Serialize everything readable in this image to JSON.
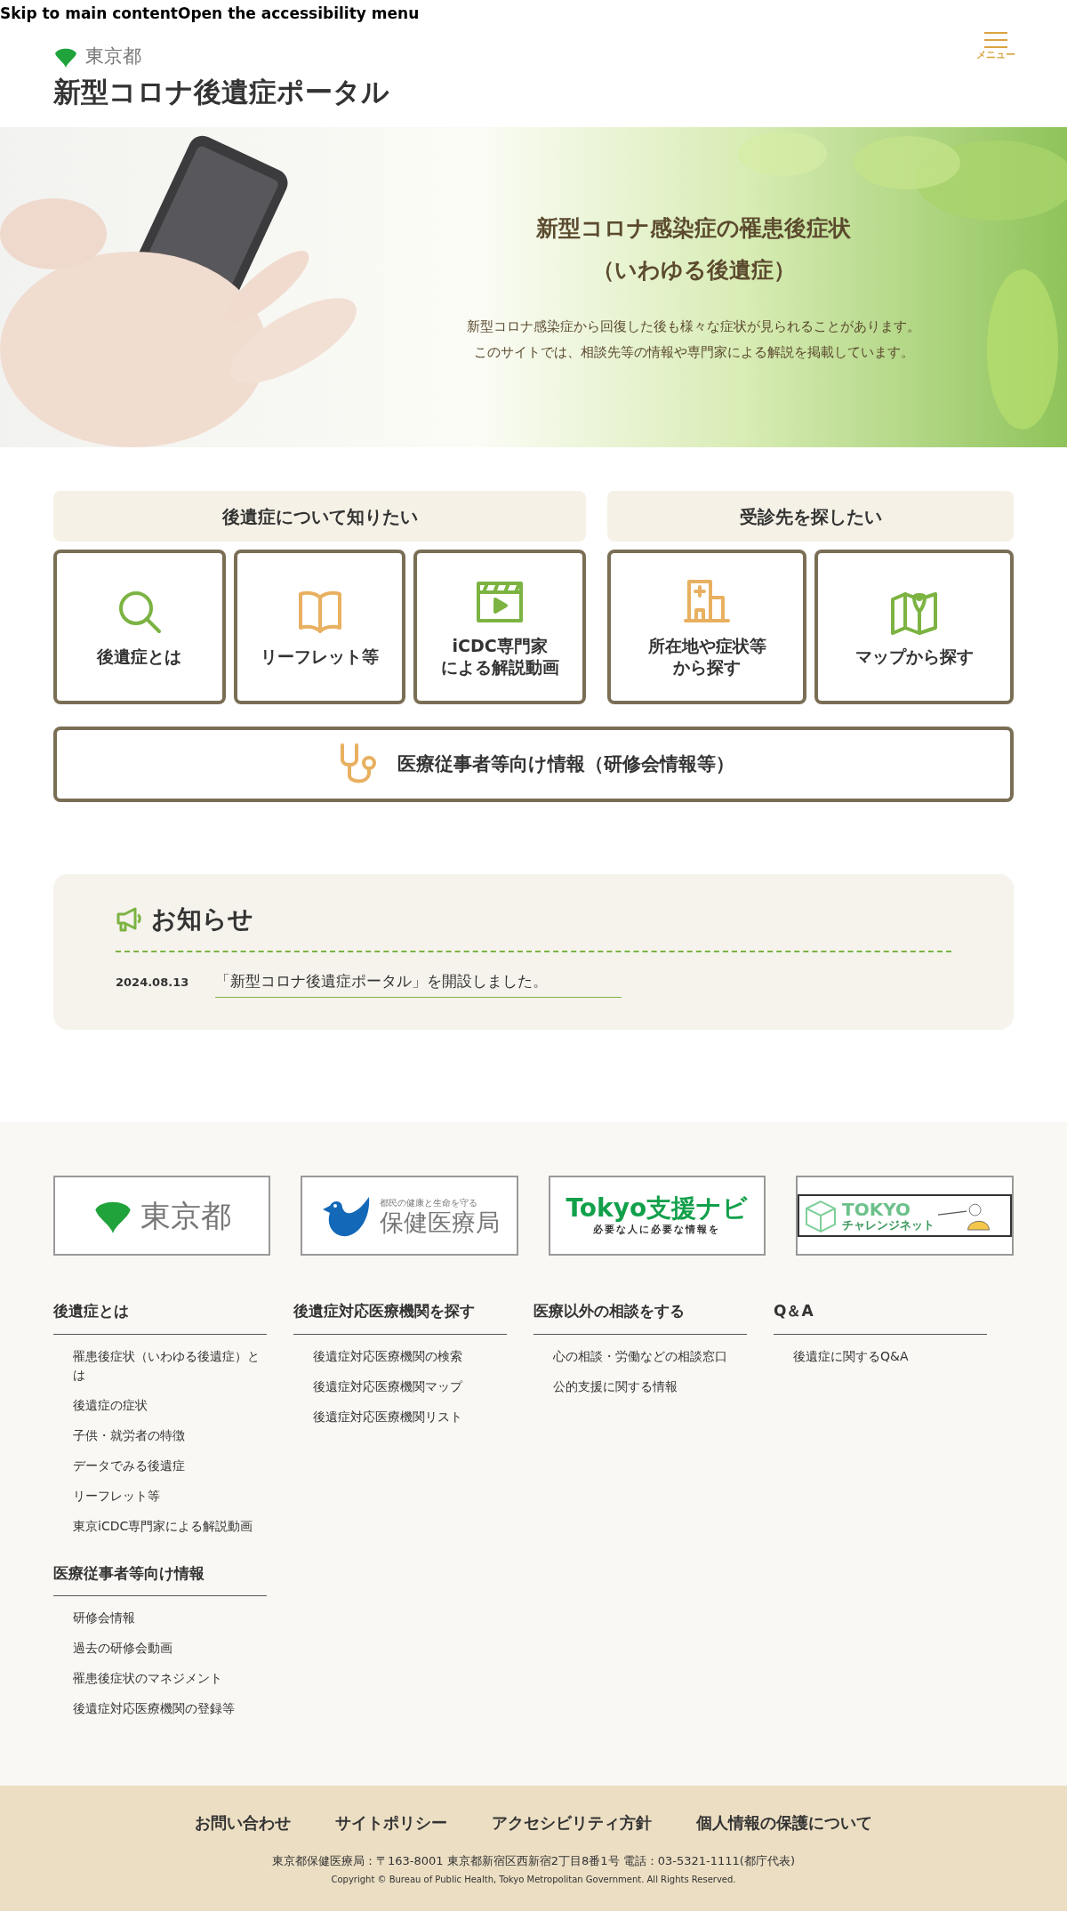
{
  "skip_links": [
    "Skip to main content",
    "Open the accessibility menu"
  ],
  "header": {
    "org": "東京都",
    "title": "新型コロナ後遺症ポータル",
    "menu_label": "メニュー"
  },
  "hero": {
    "kind": "picture",
    "heading_lines": [
      "新型コロナ感染症の罹患後症状",
      "（いわゆる後遺症）"
    ],
    "lead_lines": [
      "新型コロナ感染症から回復した後も様々な症状が見られることがあります。",
      "このサイトでは、相談先等の情報や専門家による解説を掲載しています。"
    ]
  },
  "groups": [
    {
      "heading": "後遺症について知りたい",
      "tiles": [
        {
          "lines": [
            "後遺症とは"
          ],
          "kind": "search"
        },
        {
          "lines": [
            "リーフレット等"
          ],
          "kind": "book"
        },
        {
          "lines": [
            "iCDC専門家",
            "による解説動画"
          ],
          "kind": "video"
        }
      ]
    },
    {
      "heading": "受診先を探したい",
      "tiles": [
        {
          "lines": [
            "所在地や症状等",
            "から探す"
          ],
          "kind": "hospital"
        },
        {
          "lines": [
            "マップから探す"
          ],
          "kind": "map"
        }
      ]
    }
  ],
  "wide_tile": {
    "label": "医療従事者等向け情報（研修会情報等）",
    "kind": "stethoscope"
  },
  "news": {
    "heading": "お知らせ",
    "items": [
      {
        "date": "2024.08.13",
        "text": "「新型コロナ後遺症ポータル」を開設しました。"
      }
    ]
  },
  "logos": [
    {
      "kind": "tokyo",
      "text": "東京都"
    },
    {
      "kind": "bureau",
      "tagline": "都民の健康と生命を守る",
      "text": "保健医療局"
    },
    {
      "kind": "navi",
      "text": "Tokyo支援ナビ",
      "tagline": "必要な人に必要な情報を"
    },
    {
      "kind": "challenge",
      "text": "TOKYO",
      "tagline": "チャレンジネット"
    }
  ],
  "footer_columns": [
    {
      "sections": [
        {
          "heading": "後遺症とは",
          "links": [
            "罹患後症状（いわゆる後遺症）とは",
            "後遺症の症状",
            "子供・就労者の特徴",
            "データでみる後遺症",
            "リーフレット等",
            "東京iCDC専門家による解説動画"
          ]
        },
        {
          "heading": "医療従事者等向け情報",
          "links": [
            "研修会情報",
            "過去の研修会動画",
            "罹患後症状のマネジメント",
            "後遺症対応医療機関の登録等"
          ]
        }
      ]
    },
    {
      "sections": [
        {
          "heading": "後遺症対応医療機関を探す",
          "links": [
            "後遺症対応医療機関の検索",
            "後遺症対応医療機関マップ",
            "後遺症対応医療機関リスト"
          ]
        }
      ]
    },
    {
      "sections": [
        {
          "heading": "医療以外の相談をする",
          "links": [
            "心の相談・労働などの相談窓口",
            "公的支援に関する情報"
          ]
        }
      ]
    },
    {
      "sections": [
        {
          "heading": "Q＆A",
          "links": [
            "後遺症に関するQ&A"
          ]
        }
      ]
    }
  ],
  "bottom": {
    "links": [
      "お問い合わせ",
      "サイトポリシー",
      "アクセシビリティ方針",
      "個人情報の保護について"
    ],
    "address": "東京都保健医療局：〒163-8001 東京都新宿区西新宿2丁目8番1号 電話：03-5321-1111(都庁代表)",
    "copyright": "Copyright © Bureau of Public Health, Tokyo Metropolitan Government. All Rights Reserved."
  }
}
